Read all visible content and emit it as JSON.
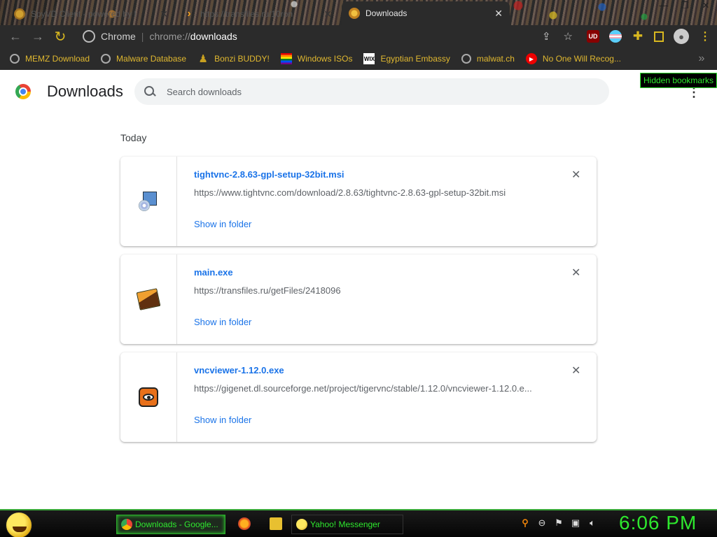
{
  "browser": {
    "tabs": [
      {
        "label": "SpyVD Client - powered by Eyel",
        "icon": "eye-icon",
        "active": false
      },
      {
        "label": "https://transfiles.ru/10ron",
        "icon": "arrow-icon",
        "active": false
      },
      {
        "label": "Downloads",
        "icon": "downloads-favicon",
        "active": true
      }
    ],
    "close_glyph": "✕",
    "window_controls": {
      "minimize": "—",
      "restore": "❐",
      "close": "✕"
    },
    "omnibox": {
      "site_name": "Chrome",
      "scheme": "chrome://",
      "path": "downloads"
    },
    "bookmarks": [
      {
        "label": "MEMZ Download",
        "icon": "globe-icon"
      },
      {
        "label": "Malware Database",
        "icon": "globe-icon"
      },
      {
        "label": "Bonzi BUDDY!",
        "icon": "bonzi-icon"
      },
      {
        "label": "Windows ISOs",
        "icon": "rainbow-flag-icon"
      },
      {
        "label": "Egyptian Embassy",
        "icon": "wix-icon"
      },
      {
        "label": "malwat.ch",
        "icon": "globe-icon"
      },
      {
        "label": "No One Will Recog...",
        "icon": "youtube-icon"
      }
    ],
    "tooltip": "Hidden bookmarks"
  },
  "downloads_page": {
    "title": "Downloads",
    "search_placeholder": "Search downloads",
    "section_label": "Today",
    "items": [
      {
        "filename": "tightvnc-2.8.63-gpl-setup-32bit.msi",
        "url": "https://www.tightvnc.com/download/2.8.63/tightvnc-2.8.63-gpl-setup-32bit.msi",
        "action": "Show in folder",
        "icon": "msi-installer-icon"
      },
      {
        "filename": "main.exe",
        "url": "https://transfiles.ru/getFiles/2418096",
        "action": "Show in folder",
        "icon": "exe-icon"
      },
      {
        "filename": "vncviewer-1.12.0.exe",
        "url": "https://gigenet.dl.sourceforge.net/project/tigervnc/stable/1.12.0/vncviewer-1.12.0.e...",
        "action": "Show in folder",
        "icon": "tigervnc-icon"
      }
    ]
  },
  "taskbar": {
    "items": [
      {
        "label": "Downloads - Google...",
        "icon": "chrome-icon",
        "active": true
      },
      {
        "label": "Yahoo! Messenger",
        "icon": "yahoo-smiley-icon",
        "active": false
      }
    ],
    "clock": "6:06 PM"
  },
  "colors": {
    "accent_link": "#1a73e8",
    "taskbar_green": "#2ee82e",
    "toolbar_yellow": "#d9b820",
    "dark_chrome": "#2b2b2b"
  }
}
